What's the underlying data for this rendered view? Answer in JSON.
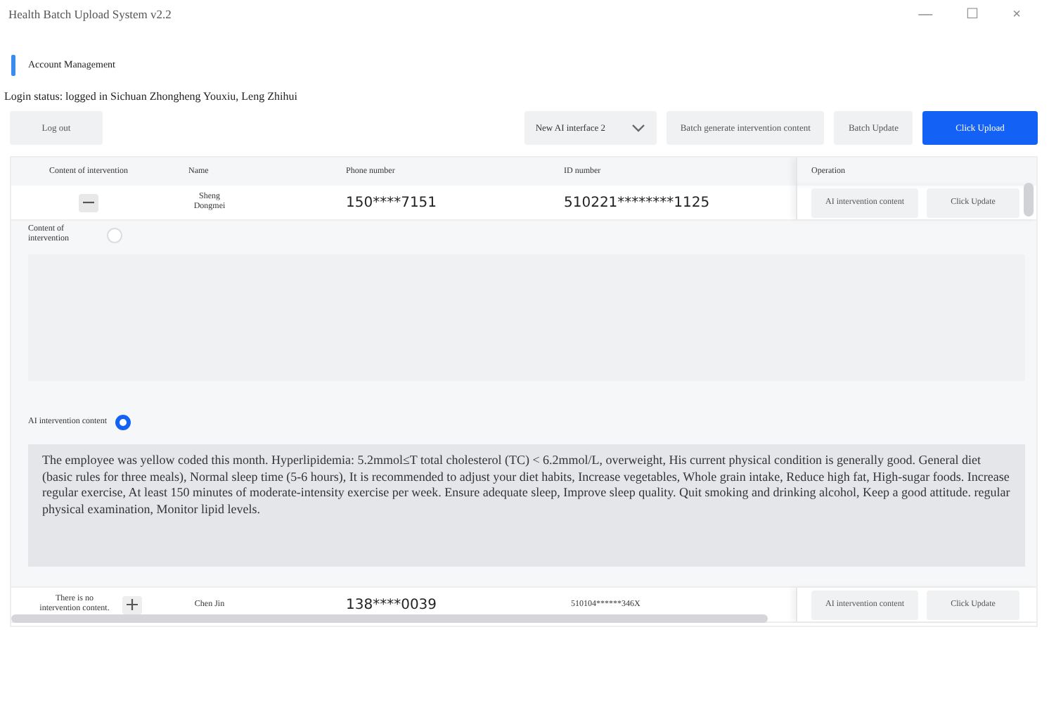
{
  "window": {
    "title": "Health Batch Upload System v2.2",
    "controls": [
      "—",
      "☐",
      "×"
    ]
  },
  "section_title": "Account Management",
  "login_status": "Login status: logged in Sichuan Zhongheng Youxiu, Leng Zhihui",
  "toolbar": {
    "logout": "Log out",
    "interface_select": {
      "value": "New AI interface 2"
    },
    "buttons": [
      {
        "label": "Batch generate intervention content",
        "primary": false
      },
      {
        "label": "Batch Update",
        "primary": false
      },
      {
        "label": "Click Upload",
        "primary": true
      }
    ]
  },
  "table": {
    "columns": [
      "Content of intervention",
      "Name",
      "Phone number",
      "ID number",
      "Operation"
    ],
    "rows": [
      {
        "expanded": true,
        "name": "Sheng Dongmei",
        "phone": "150****7151",
        "id_number": "510221********1125",
        "actions": [
          "AI intervention content",
          "Click Update"
        ],
        "details": [
          {
            "label": "Content of intervention",
            "selected": false
          },
          {
            "label": "AI intervention content",
            "selected": true,
            "text": "The employee was yellow coded this month. Hyperlipidemia: 5.2mmol≤T total cholesterol (TC) < 6.2mmol/L, overweight, His current physical condition is generally good. General diet (basic rules for three meals), Normal sleep time (5-6 hours), It is recommended to adjust your diet habits, Increase vegetables, Whole grain intake, Reduce high fat, High-sugar foods. Increase regular exercise, At least 150 minutes of moderate-intensity exercise per week. Ensure adequate sleep, Improve sleep quality. Quit smoking and drinking alcohol, Keep a good attitude. regular physical examination, Monitor lipid levels."
          }
        ]
      },
      {
        "expanded": false,
        "content": "There is no intervention content.",
        "name": "Chen Jin",
        "phone": "138****0039",
        "id_number": "510104******346X",
        "actions": [
          "AI intervention content",
          "Click Update"
        ]
      }
    ]
  }
}
